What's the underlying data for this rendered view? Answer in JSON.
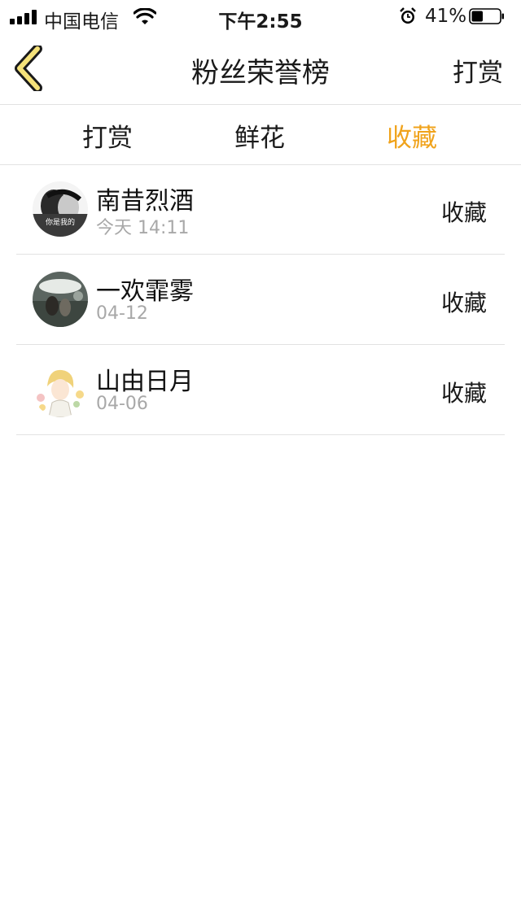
{
  "status_bar": {
    "carrier": "中国电信",
    "time": "下午2:55",
    "battery_percent": "41%",
    "battery_level": 0.41,
    "icons": [
      "signal-icon",
      "wifi-icon",
      "alarm-icon",
      "battery-icon"
    ]
  },
  "navbar": {
    "back_icon": "chevron-left-icon",
    "title": "粉丝荣誉榜",
    "right_label": "打赏"
  },
  "tabs": [
    {
      "label": "打赏",
      "active": false
    },
    {
      "label": "鲜花",
      "active": false
    },
    {
      "label": "收藏",
      "active": true
    }
  ],
  "colors": {
    "accent": "#f0a31c",
    "back_icon_fill": "#f5e27a",
    "divider": "#e2e2e2",
    "secondary_text": "#a8a8a8"
  },
  "fans": [
    {
      "name": "南昔烈酒",
      "date": "今天 14:11",
      "action": "收藏",
      "avatar_caption": "你是我的"
    },
    {
      "name": "一欢霏雾",
      "date": "04-12",
      "action": "收藏"
    },
    {
      "name": "山由日月",
      "date": "04-06",
      "action": "收藏"
    }
  ]
}
